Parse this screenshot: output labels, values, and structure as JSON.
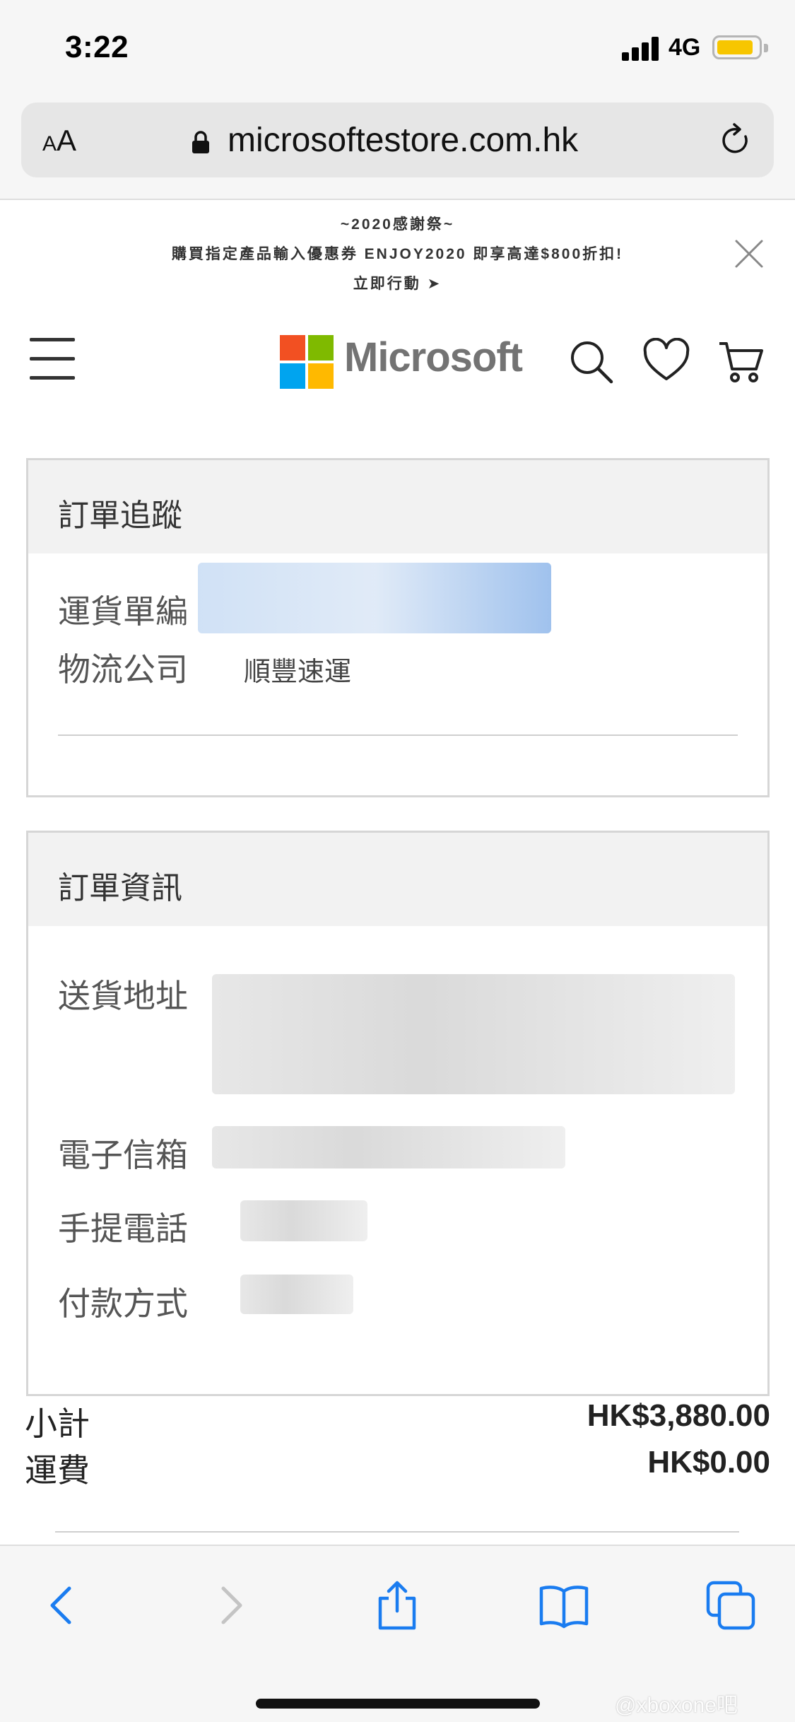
{
  "status_bar": {
    "time": "3:22",
    "network": "4G",
    "battery_color": "#f7c600"
  },
  "browser": {
    "text_size_small": "A",
    "text_size_large": "A",
    "url": "microsoftestore.com.hk",
    "lock_icon": "lock-icon",
    "reload_icon": "reload-icon"
  },
  "promo": {
    "line1": "~2020感謝祭~",
    "line2": "購買指定產品輸入優惠券 ENJOY2020 即享高達$800折扣!",
    "line3": "立即行動 ➤",
    "close_icon": "close-icon"
  },
  "header": {
    "brand": "Microsoft",
    "logo_colors": [
      "#f25022",
      "#7fba00",
      "#00a4ef",
      "#ffb900"
    ],
    "icons": [
      "menu-icon",
      "search-icon",
      "heart-icon",
      "cart-icon"
    ]
  },
  "tracking": {
    "title": "訂單追蹤",
    "waybill_label": "運貨單編",
    "carrier_label": "物流公司",
    "carrier_value": "順豐速運"
  },
  "order_info": {
    "title": "訂單資訊",
    "address_label": "送貨地址",
    "email_label": "電子信箱",
    "phone_label": "手提電話",
    "payment_label": "付款方式"
  },
  "totals": {
    "subtotal_label": "小計",
    "subtotal_value": "HK$3,880.00",
    "shipping_label": "運費",
    "shipping_value": "HK$0.00"
  },
  "toolbar": {
    "icons": [
      "back-icon",
      "forward-icon",
      "share-icon",
      "bookmarks-icon",
      "tabs-icon"
    ],
    "accent": "#1a7cf0"
  },
  "watermark": "@xboxone吧"
}
